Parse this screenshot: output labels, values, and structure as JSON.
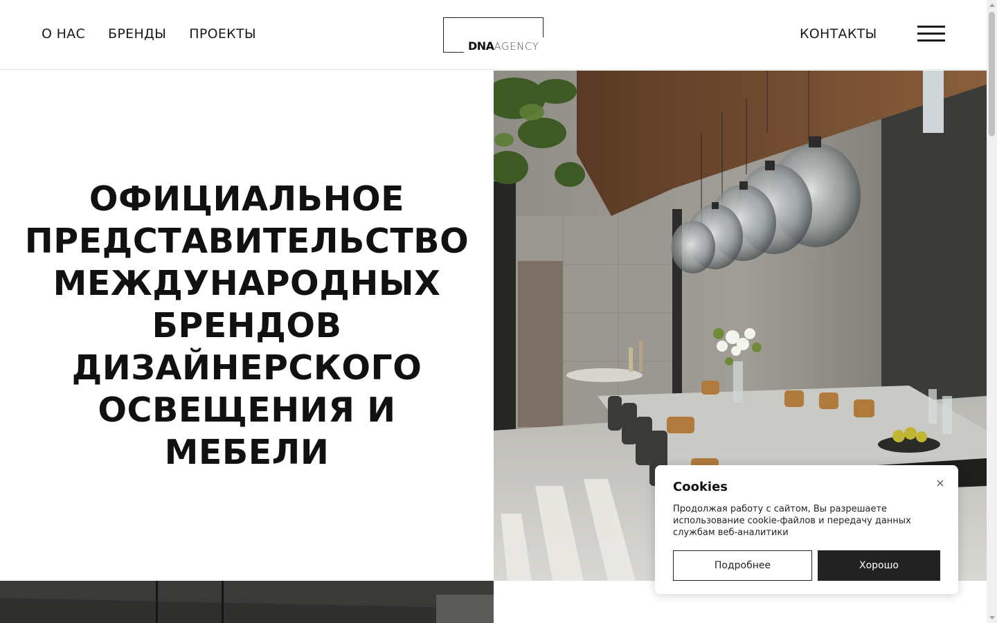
{
  "header": {
    "nav": [
      {
        "label": "О НАС"
      },
      {
        "label": "БРЕНДЫ"
      },
      {
        "label": "ПРОЕКТЫ"
      }
    ],
    "contacts_label": "КОНТАКТЫ",
    "logo": {
      "bold": "DNA",
      "light": "AGENCY"
    },
    "menu_icon": "hamburger-menu-icon"
  },
  "hero": {
    "title": "ОФИЦИАЛЬНОЕ ПРЕДСТАВИТЕЛЬСТВО МЕЖДУНАРОДНЫХ БРЕНДОВ ДИЗАЙНЕРСКОГО ОСВЕЩЕНИЯ И МЕБЕЛИ",
    "title_lines": [
      "ОФИЦИАЛЬНОЕ",
      "ПРЕДСТАВИТЕЛЬСТВО",
      "МЕЖДУНАРОДНЫХ",
      "БРЕНДОВ",
      "ДИЗАЙНЕРСКОГО",
      "ОСВЕЩЕНИЯ И",
      "МЕБЕЛИ"
    ]
  },
  "cookie": {
    "title": "Cookies",
    "text": "Продолжая работу с сайтом, Вы разрешаете использование cookie-файлов и передачу данных службам веб-аналитики",
    "more_label": "Подробнее",
    "ok_label": "Хорошо",
    "close_icon": "close-icon"
  },
  "colors": {
    "text": "#111111",
    "button_dark": "#222222",
    "divider": "#e6e6e6"
  }
}
